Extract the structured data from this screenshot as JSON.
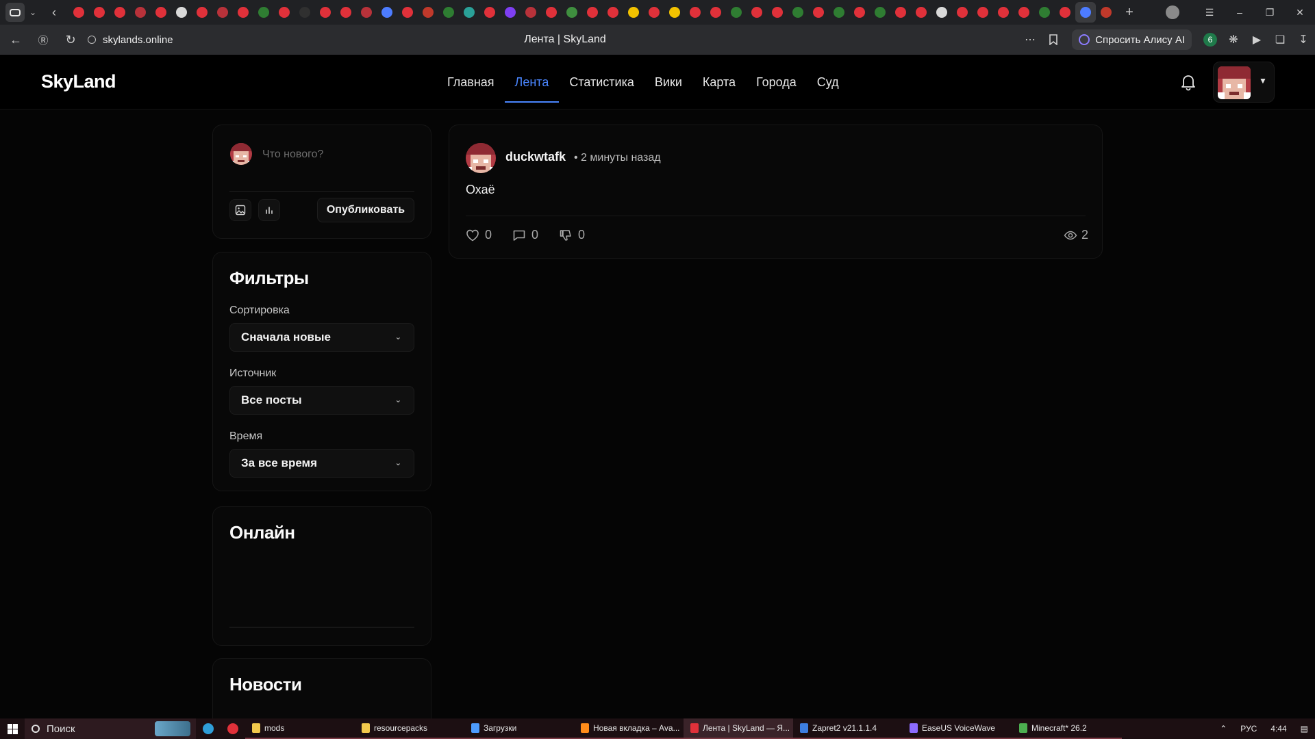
{
  "browser": {
    "tab_title": "Лента | SkyLand",
    "url": "skylands.online",
    "alice_label": "Спросить Алису AI",
    "badge_count": "6",
    "favicon_colors": [
      "#e0313a",
      "#e0313a",
      "#e0313a",
      "#b8323a",
      "#e0313a",
      "#d9d9d9",
      "#e0313a",
      "#b8323a",
      "#e0313a",
      "#2f7d32",
      "#e0313a",
      "#303030",
      "#e0313a",
      "#e0313a",
      "#b8323a",
      "#4d7cff",
      "#e0313a",
      "#c0392b",
      "#2e7d32",
      "#2aa198",
      "#e0313a",
      "#7e3ff2",
      "#b8323a",
      "#e0313a",
      "#3f8f3f",
      "#e0313a",
      "#e0313a",
      "#f2c200",
      "#e0313a",
      "#f2c200",
      "#e0313a",
      "#e0313a",
      "#2f7d32",
      "#e0313a",
      "#e0313a",
      "#2f7d32",
      "#e0313a",
      "#2f7d32",
      "#e0313a",
      "#2f7d32",
      "#e0313a",
      "#e0313a",
      "#d9d9d9",
      "#e0313a",
      "#e0313a",
      "#e0313a",
      "#e0313a",
      "#2f7d32",
      "#e0313a",
      "#4d7cff",
      "#c0392b"
    ]
  },
  "site": {
    "logo": "SkyLand",
    "nav": [
      {
        "label": "Главная",
        "active": false
      },
      {
        "label": "Лента",
        "active": true
      },
      {
        "label": "Статистика",
        "active": false
      },
      {
        "label": "Вики",
        "active": false
      },
      {
        "label": "Карта",
        "active": false
      },
      {
        "label": "Города",
        "active": false
      },
      {
        "label": "Суд",
        "active": false
      }
    ],
    "accent_color": "#4a86ff"
  },
  "composer": {
    "placeholder": "Что нового?",
    "publish_label": "Опубликовать"
  },
  "filters": {
    "title": "Фильтры",
    "sort_label": "Сортировка",
    "sort_value": "Сначала новые",
    "source_label": "Источник",
    "source_value": "Все посты",
    "time_label": "Время",
    "time_value": "За все время"
  },
  "online": {
    "title": "Онлайн"
  },
  "news": {
    "title": "Новости"
  },
  "post": {
    "author": "duckwtafk",
    "time": "• 2 минуты назад",
    "text": "Охаё",
    "likes": "0",
    "comments": "0",
    "dislikes": "0",
    "views": "2"
  },
  "taskbar": {
    "search_label": "Поиск",
    "apps": [
      {
        "label": "mods",
        "color": "#f2c94c",
        "active": false
      },
      {
        "label": "resourcepacks",
        "color": "#f2c94c",
        "active": false
      },
      {
        "label": "Загрузки",
        "color": "#4d9cff",
        "active": false
      },
      {
        "label": "Новая вкладка – Ava...",
        "color": "#ff8c1a",
        "active": false
      },
      {
        "label": "Лента | SkyLand — Я...",
        "color": "#e0313a",
        "active": true
      },
      {
        "label": "Zapret2 v21.1.1.4",
        "color": "#3d7ee0",
        "active": false
      },
      {
        "label": "EaseUS VoiceWave",
        "color": "#8c6cff",
        "active": false
      },
      {
        "label": "Minecraft* 26.2",
        "color": "#4caf50",
        "active": false
      }
    ],
    "lang": "РУС",
    "clock": "4:44"
  }
}
